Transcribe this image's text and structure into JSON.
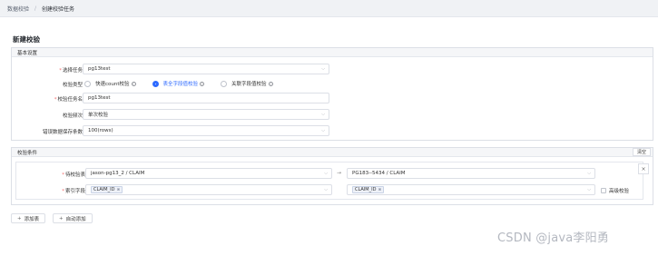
{
  "breadcrumb": [
    "数据校验",
    "创建校验任务"
  ],
  "breadcrumb_sep": "/",
  "page_title": "新建校验",
  "basic": {
    "header": "基本设置",
    "task": {
      "label": "选择任务",
      "value": "pg13test"
    },
    "type": {
      "label": "校验类型",
      "options": [
        "快速count校验",
        "表全字段值校验",
        "关联字段值校验"
      ],
      "selected_index": 1
    },
    "name": {
      "label": "校验任务名",
      "value": "pg13test"
    },
    "frequency": {
      "label": "校验频次",
      "value": "单次校验"
    },
    "error_limit": {
      "label": "错误数据保存条数",
      "value": "100(rows)"
    }
  },
  "conditions": {
    "header": "校验条件",
    "clear_label": "清空",
    "source_table": {
      "label": "待校验表",
      "value": "jason-pg13_2 / CLAIM"
    },
    "target_table": {
      "value": "PG183--5434 / CLAIM"
    },
    "index": {
      "label": "索引字段",
      "source_tag": "CLAIM_ID",
      "target_tag": "CLAIM_ID"
    },
    "advanced_label": "高级校验",
    "close_label": "×"
  },
  "actions": {
    "add_table": "添加表",
    "auto_add": "自动添加"
  },
  "watermark": "CSDN @java李阳勇",
  "icons": {
    "required": "*",
    "chevron": "⌵",
    "arrow": "→",
    "info": "i",
    "plus": "+",
    "tag_close": "⊗"
  }
}
